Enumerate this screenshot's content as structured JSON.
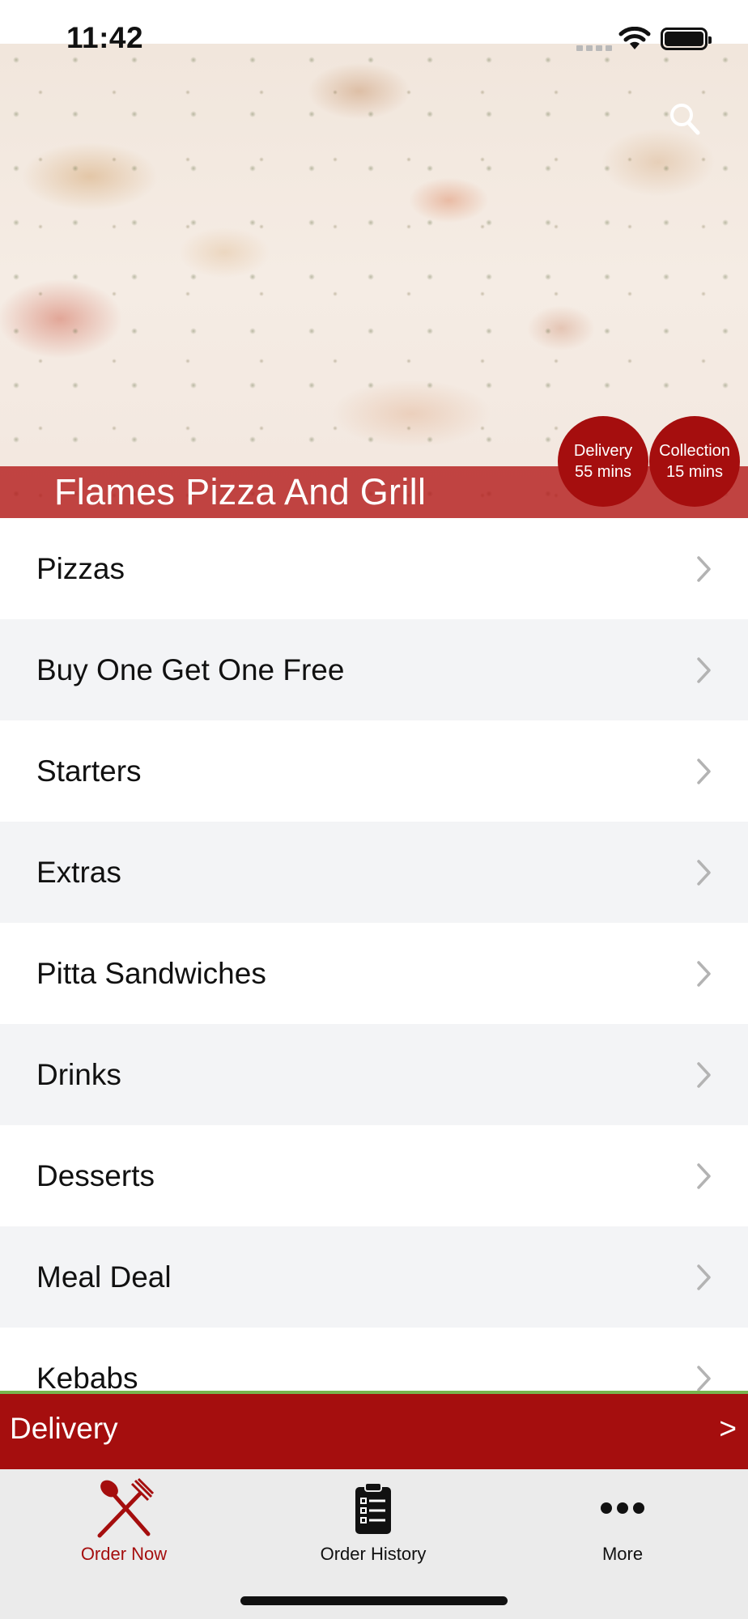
{
  "status_bar": {
    "time": "11:42"
  },
  "hero": {
    "restaurant_name": "Flames Pizza And Grill",
    "delivery_badge": {
      "label": "Delivery",
      "time": "55 mins"
    },
    "collection_badge": {
      "label": "Collection",
      "time": "15 mins"
    }
  },
  "menu": {
    "items": [
      {
        "label": "Pizzas"
      },
      {
        "label": "Buy One Get One Free"
      },
      {
        "label": "Starters"
      },
      {
        "label": "Extras"
      },
      {
        "label": "Pitta Sandwiches"
      },
      {
        "label": "Drinks"
      },
      {
        "label": "Desserts"
      },
      {
        "label": "Meal Deal"
      },
      {
        "label": "Kebabs"
      }
    ]
  },
  "delivery_bar": {
    "label": "Delivery",
    "arrow": ">"
  },
  "tab_bar": {
    "tabs": [
      {
        "label": "Order Now",
        "icon": "fork-knife-icon"
      },
      {
        "label": "Order History",
        "icon": "clipboard-icon"
      },
      {
        "label": "More",
        "icon": "more-dots-icon"
      }
    ]
  },
  "colors": {
    "brand_red": "#a50e0e",
    "accent_green": "#78b44e",
    "tab_bar_bg": "#ebebeb"
  }
}
